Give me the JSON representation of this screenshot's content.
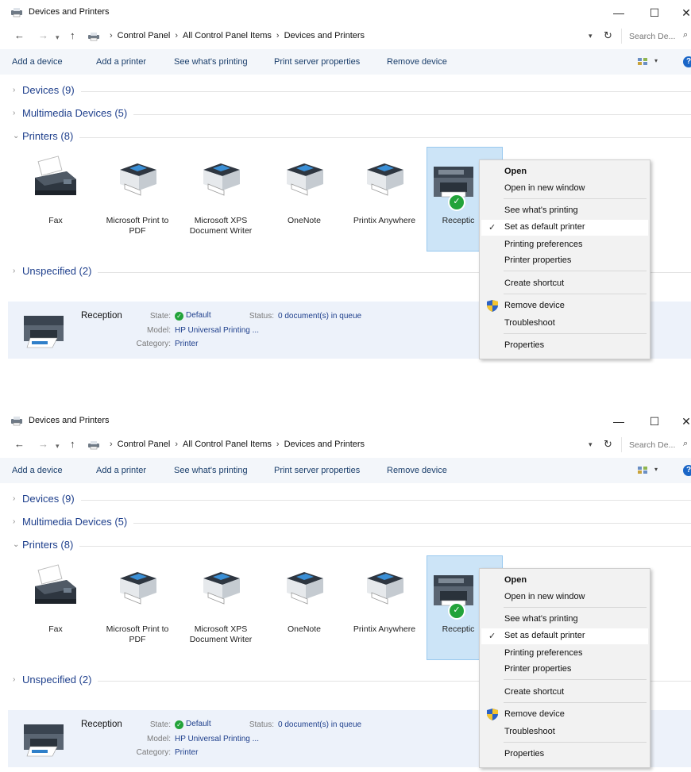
{
  "screens": [
    {
      "title": "Devices and Printers",
      "window_controls": {
        "minimize": "—",
        "maximize": "☐",
        "close": "✕"
      },
      "breadcrumb": [
        "Control Panel",
        "All Control Panel Items",
        "Devices and Printers"
      ],
      "search_placeholder": "Search De...",
      "commands": [
        "Add a device",
        "Add a printer",
        "See what's printing",
        "Print server properties",
        "Remove device"
      ],
      "groups": {
        "devices": "Devices (9)",
        "multimedia": "Multimedia Devices (5)",
        "printers": "Printers (8)",
        "unspecified": "Unspecified (2)"
      },
      "printers": [
        {
          "label": "Fax",
          "icon": "fax-icon"
        },
        {
          "label": "Microsoft Print to PDF",
          "icon": "printer-icon"
        },
        {
          "label": "Microsoft XPS Document Writer",
          "icon": "printer-icon"
        },
        {
          "label": "OneNote",
          "icon": "printer-icon"
        },
        {
          "label": "Printix Anywhere",
          "icon": "printer-icon"
        },
        {
          "label": "Receptic",
          "icon": "mfp-printer-icon",
          "selected": true,
          "default": true
        }
      ],
      "details": {
        "name": "Reception",
        "state_label": "State:",
        "state_value": "Default",
        "status_label": "Status:",
        "status_value": "0 document(s) in queue",
        "model_label": "Model:",
        "model_value": "HP Universal Printing ...",
        "category_label": "Category:",
        "category_value": "Printer"
      },
      "context_menu": {
        "items": [
          "Open",
          "Open in new window",
          "See what's printing",
          "Set as default printer",
          "Printing preferences",
          "Printer properties",
          "Create shortcut",
          "Remove device",
          "Troubleshoot",
          "Properties"
        ],
        "checked_item": "Set as default printer",
        "check_glyph": "✓"
      }
    },
    {
      "title": "Devices and Printers",
      "window_controls": {
        "minimize": "—",
        "maximize": "☐",
        "close": "✕"
      },
      "breadcrumb": [
        "Control Panel",
        "All Control Panel Items",
        "Devices and Printers"
      ],
      "search_placeholder": "Search De...",
      "commands": [
        "Add a device",
        "Add a printer",
        "See what's printing",
        "Print server properties",
        "Remove device"
      ],
      "groups": {
        "devices": "Devices (9)",
        "multimedia": "Multimedia Devices (5)",
        "printers": "Printers (8)",
        "unspecified": "Unspecified (2)"
      },
      "printers": [
        {
          "label": "Fax",
          "icon": "fax-icon"
        },
        {
          "label": "Microsoft Print to PDF",
          "icon": "printer-icon"
        },
        {
          "label": "Microsoft XPS Document Writer",
          "icon": "printer-icon"
        },
        {
          "label": "OneNote",
          "icon": "printer-icon"
        },
        {
          "label": "Printix Anywhere",
          "icon": "printer-icon"
        },
        {
          "label": "Receptic",
          "icon": "mfp-printer-icon",
          "selected": true,
          "default": true
        }
      ],
      "details": {
        "name": "Reception",
        "state_label": "State:",
        "state_value": "Default",
        "status_label": "Status:",
        "status_value": "0 document(s) in queue",
        "model_label": "Model:",
        "model_value": "HP Universal Printing ...",
        "category_label": "Category:",
        "category_value": "Printer"
      },
      "context_menu": {
        "items": [
          "Open",
          "Open in new window",
          "See what's printing",
          "Set as default printer",
          "Printing preferences",
          "Printer properties",
          "Create shortcut",
          "Remove device",
          "Troubleshoot",
          "Properties"
        ],
        "checked_item": "Set as default printer",
        "check_glyph": "✓"
      }
    }
  ]
}
